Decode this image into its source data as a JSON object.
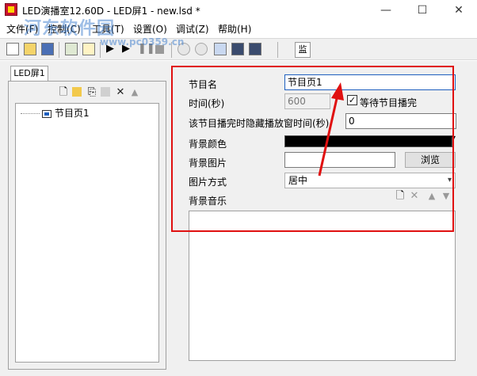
{
  "titlebar": {
    "title": "LED演播室12.60D - LED屏1 - new.lsd *",
    "minimize": "—",
    "maximize": "☐",
    "close": "✕"
  },
  "menu": [
    "文件(F)",
    "控制(C)",
    "工具(T)",
    "设置(O)",
    "调试(Z)",
    "帮助(H)"
  ],
  "watermark": {
    "text": "河东软件园",
    "sub": "www.pc0359.cn"
  },
  "toolbar": {
    "monitor_label": "监"
  },
  "tab": {
    "label": "LED屏1"
  },
  "tree": {
    "nodes": [
      {
        "label": "节目页1"
      }
    ]
  },
  "form": {
    "name_label": "节目名",
    "name_value": "节目页1",
    "time_label": "时间(秒)",
    "time_value": "600",
    "wait_checkbox_label": "等待节目播完",
    "wait_checked": true,
    "hide_label": "该节目播完时隐藏播放窗时间(秒)",
    "hide_value": "0",
    "bg_color_label": "背景颜色",
    "bg_color_value": "#000000",
    "bg_image_label": "背景图片",
    "bg_image_value": "",
    "browse_button": "浏览",
    "image_mode_label": "图片方式",
    "image_mode_value": "居中",
    "bg_music_label": "背景音乐"
  },
  "icons": {
    "check": "✓",
    "dropdown": "▾",
    "delete": "✕",
    "up": "▲",
    "down": "▼"
  },
  "colors": {
    "highlight_box": "#e01010",
    "selected_input_border": "#1e5fbf"
  }
}
